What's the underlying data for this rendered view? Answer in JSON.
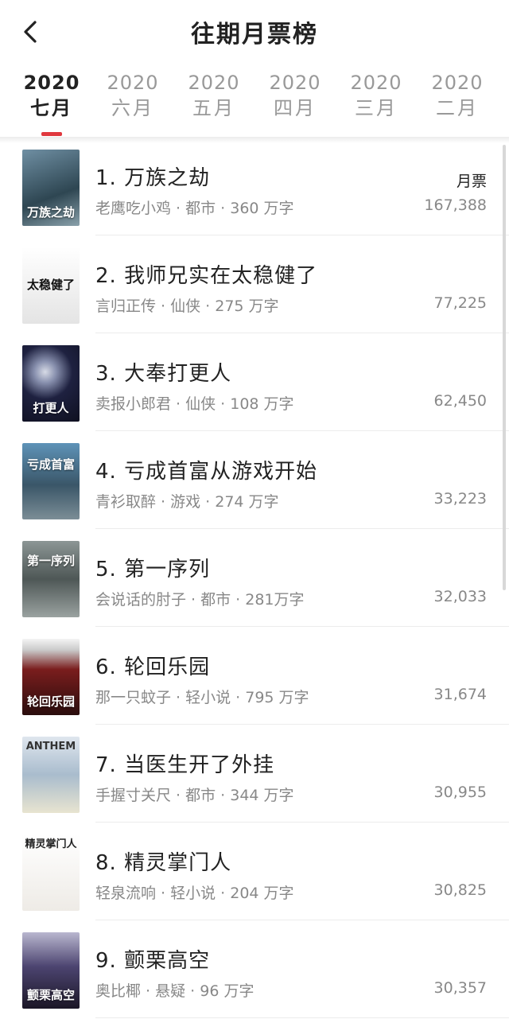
{
  "header": {
    "title": "往期月票榜"
  },
  "tabs": [
    {
      "year": "2020",
      "month": "七月"
    },
    {
      "year": "2020",
      "month": "六月"
    },
    {
      "year": "2020",
      "month": "五月"
    },
    {
      "year": "2020",
      "month": "四月"
    },
    {
      "year": "2020",
      "month": "三月"
    },
    {
      "year": "2020",
      "month": "二月"
    }
  ],
  "list": {
    "votes_label": "月票",
    "items": [
      {
        "title": "1. 万族之劫",
        "meta": "老鹰吃小鸡 · 都市 · 360 万字",
        "votes": "167,388",
        "cover_text": "万族之劫",
        "cover_color": "#3d5a6a"
      },
      {
        "title": "2. 我师兄实在太稳健了",
        "meta": "言归正传 · 仙侠 · 275 万字",
        "votes": "77,225",
        "cover_text": "太稳健了",
        "cover_color": "#e9e9e9"
      },
      {
        "title": "3. 大奉打更人",
        "meta": "卖报小郎君 · 仙侠 · 108 万字",
        "votes": "62,450",
        "cover_text": "打更人",
        "cover_color": "#1f2240"
      },
      {
        "title": "4. 亏成首富从游戏开始",
        "meta": "青衫取醉 · 游戏 · 274 万字",
        "votes": "33,223",
        "cover_text": "亏成首富",
        "cover_color": "#3f6f8a"
      },
      {
        "title": "5. 第一序列",
        "meta": "会说话的肘子 · 都市 · 281万字",
        "votes": "32,033",
        "cover_text": "第一序列",
        "cover_color": "#58615f"
      },
      {
        "title": "6. 轮回乐园",
        "meta": "那一只蚊子 · 轻小说 · 795 万字",
        "votes": "31,674",
        "cover_text": "轮回乐园",
        "cover_color": "#4a1c1c"
      },
      {
        "title": "7. 当医生开了外挂",
        "meta": "手握寸关尺 · 都市 · 344 万字",
        "votes": "30,955",
        "cover_text": "ANTHEM",
        "cover_color": "#9bb0c4"
      },
      {
        "title": "8. 精灵掌门人",
        "meta": "轻泉流响 · 轻小说 · 204 万字",
        "votes": "30,825",
        "cover_text": "精灵掌门人",
        "cover_color": "#f1efec"
      },
      {
        "title": "9. 颤栗高空",
        "meta": "奥比椰 · 悬疑 · 96 万字",
        "votes": "30,357",
        "cover_text": "颤栗高空",
        "cover_color": "#4a3f6a"
      }
    ]
  },
  "colors": {
    "accent": "#e0383e",
    "muted_text": "#888888",
    "title_text": "#222222"
  },
  "icons": {
    "back": "chevron-left-icon"
  }
}
